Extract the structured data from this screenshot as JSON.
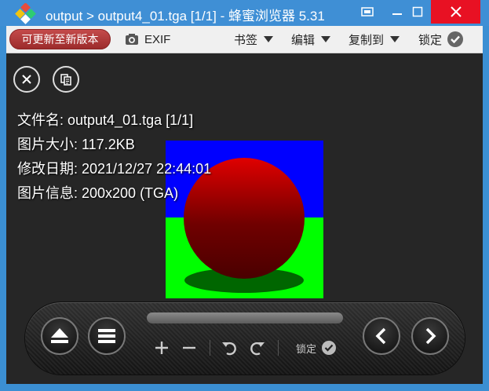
{
  "window": {
    "title": "output > output4_01.tga [1/1] - 蜂蜜浏览器 5.31",
    "colors": {
      "titlebar": "#3f8fd5",
      "close": "#e81123",
      "viewer_bg": "#262626"
    }
  },
  "toolbar": {
    "update_label": "可更新至新版本",
    "exif_label": "EXIF",
    "bookmarks_label": "书签",
    "edit_label": "编辑",
    "copy_to_label": "复制到",
    "lock_label": "锁定"
  },
  "info": {
    "filename": "文件名: output4_01.tga [1/1]",
    "size": "图片大小: 117.2KB",
    "modified": "修改日期: 2021/12/27 22:44:01",
    "details": "图片信息: 200x200 (TGA)"
  },
  "image": {
    "description_colors": {
      "sky": "#0000ff",
      "ground": "#00ff00",
      "sphere": "#c00000"
    }
  },
  "controls": {
    "lock_label": "锁定",
    "icons": [
      "eject-icon",
      "menu-icon",
      "zoom-in-icon",
      "zoom-out-icon",
      "rotate-left-icon",
      "rotate-right-icon",
      "check-icon",
      "previous-icon",
      "next-icon"
    ]
  }
}
